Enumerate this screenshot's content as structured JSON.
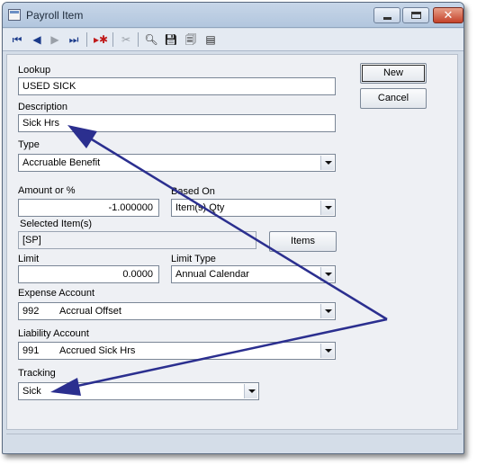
{
  "window": {
    "title": "Payroll Item"
  },
  "toolbar": {
    "icons": [
      "first-record-icon",
      "previous-record-icon",
      "next-record-icon",
      "last-record-icon",
      "new-record-icon",
      "delete-record-icon",
      "find-icon",
      "save-icon",
      "save-close-icon",
      "properties-icon"
    ]
  },
  "form": {
    "lookup": {
      "label": "Lookup",
      "value": "USED SICK"
    },
    "description": {
      "label": "Description",
      "value": "Sick Hrs"
    },
    "type": {
      "label": "Type",
      "value": "Accruable Benefit"
    },
    "amount": {
      "label": "Amount or %",
      "value": "-1.000000"
    },
    "based_on": {
      "label": "Based On",
      "value": "Item(s) Qty"
    },
    "selected_items": {
      "label": "Selected Item(s)",
      "value": "[SP]"
    },
    "items_button": "Items",
    "limit": {
      "label": "Limit",
      "value": "0.0000"
    },
    "limit_type": {
      "label": "Limit Type",
      "value": "Annual Calendar"
    },
    "expense_account": {
      "label": "Expense Account",
      "code": "992",
      "name": "Accrual Offset"
    },
    "liability_account": {
      "label": "Liability Account",
      "code": "991",
      "name": "Accrued Sick Hrs"
    },
    "tracking": {
      "label": "Tracking",
      "value": "Sick"
    }
  },
  "buttons": {
    "new": "New",
    "cancel": "Cancel"
  },
  "colors": {
    "annotation_arrow": "#2b2f8f",
    "window_bg": "#d4dde8"
  }
}
